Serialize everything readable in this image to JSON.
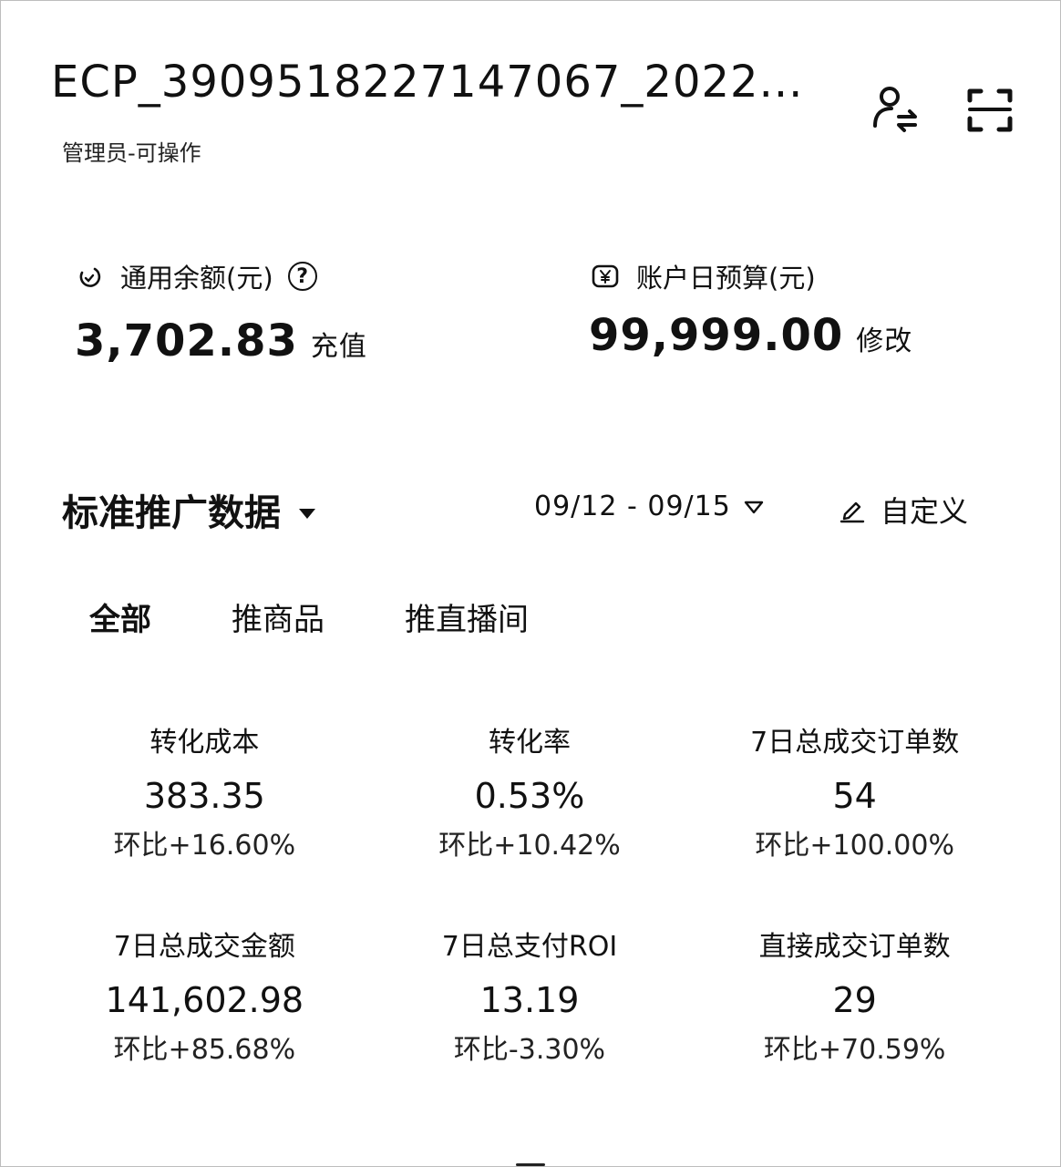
{
  "account": {
    "title": "ECP_3909518227147067_2022...",
    "role": "管理员-可操作"
  },
  "icons": {
    "switch_account": "user-switch-icon",
    "scan": "scan-icon",
    "balance": "wallet-icon",
    "budget": "yuan-badge-icon",
    "help": "question-circle-icon",
    "edit": "pencil-icon",
    "dropdown": "triangle-down-icon"
  },
  "balance": {
    "label": "通用余额(元)",
    "help_glyph": "?",
    "value": "3,702.83",
    "action": "充值"
  },
  "budget": {
    "label": "账户日预算(元)",
    "value": "99,999.00",
    "action": "修改"
  },
  "section": {
    "title": "标准推广数据",
    "date_range": "09/12 - 09/15",
    "customize": "自定义"
  },
  "tabs": [
    {
      "label": "全部",
      "active": true
    },
    {
      "label": "推商品",
      "active": false
    },
    {
      "label": "推直播间",
      "active": false
    }
  ],
  "metrics": [
    {
      "label": "转化成本",
      "value": "383.35",
      "change": "环比+16.60%"
    },
    {
      "label": "转化率",
      "value": "0.53%",
      "change": "环比+10.42%"
    },
    {
      "label": "7日总成交订单数",
      "value": "54",
      "change": "环比+100.00%"
    },
    {
      "label": "7日总成交金额",
      "value": "141,602.98",
      "change": "环比+85.68%"
    },
    {
      "label": "7日总支付ROI",
      "value": "13.19",
      "change": "环比-3.30%"
    },
    {
      "label": "直接成交订单数",
      "value": "29",
      "change": "环比+70.59%"
    }
  ]
}
